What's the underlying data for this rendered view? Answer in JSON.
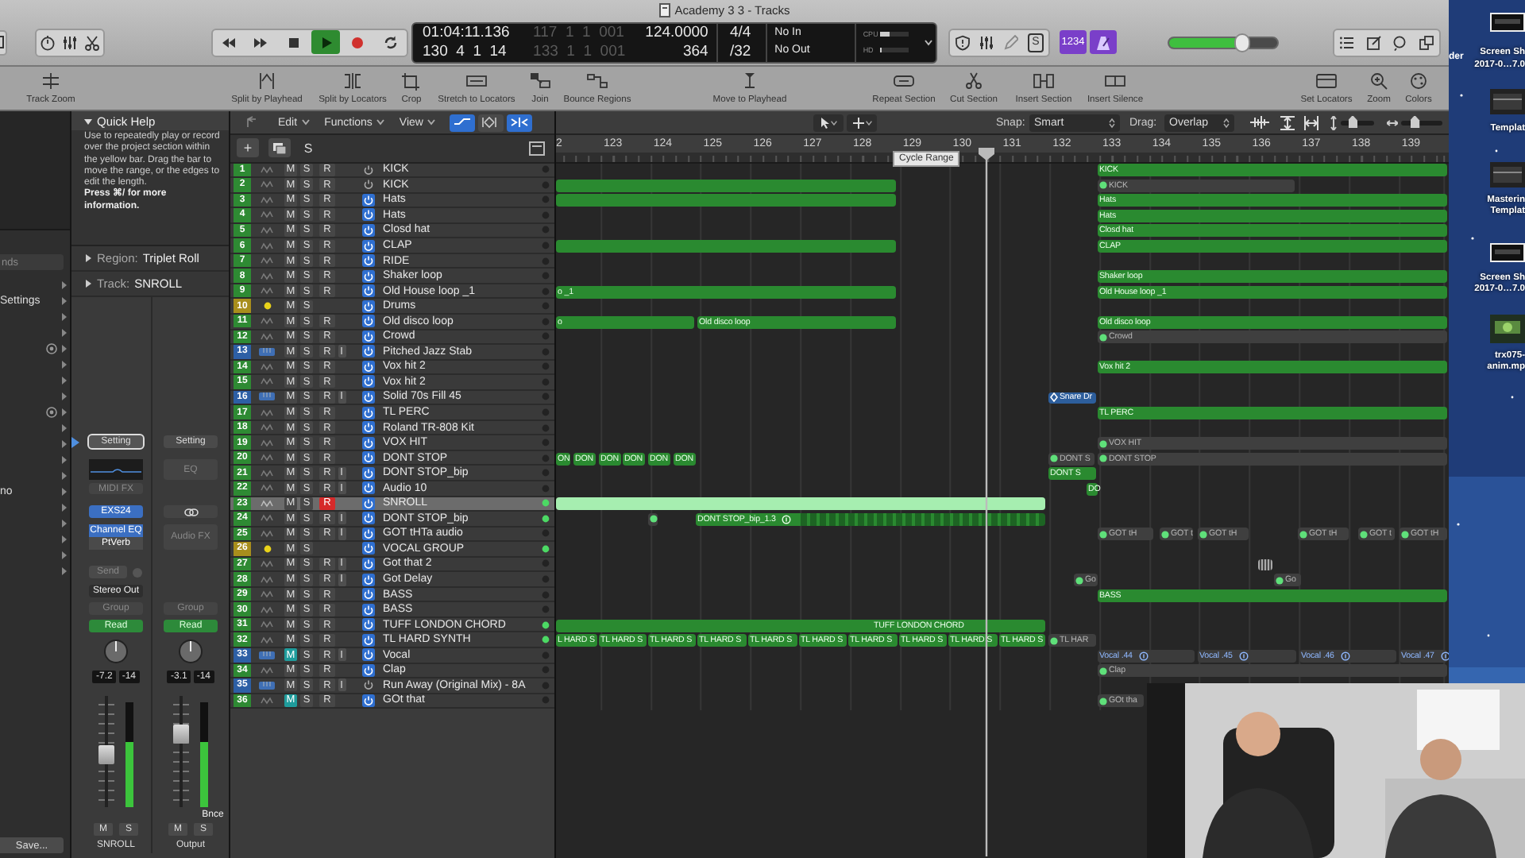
{
  "window": {
    "title": "Academy 3 3 - Tracks"
  },
  "transport": [
    {
      "kind": "rewind",
      "on": false
    },
    {
      "kind": "forward",
      "on": false
    },
    {
      "kind": "stop",
      "on": false
    },
    {
      "kind": "play",
      "on": true
    },
    {
      "kind": "record",
      "on": false
    },
    {
      "kind": "cycle",
      "on": false
    }
  ],
  "lcd": {
    "time": "01:04:11.136",
    "bars": "130  4  1  14",
    "left_locator": "117  1  1  001",
    "right_locator": "133  1  1  001",
    "tempo": "124.0000",
    "tempo_2": "364",
    "signature": "4/4",
    "division": "/32",
    "midi_in": "No In",
    "midi_out": "No Out",
    "cpu": {
      "label": "CPU",
      "level": 0.3
    },
    "hd": {
      "label": "HD",
      "level": 0.05
    }
  },
  "editor_button": {
    "label": "S"
  },
  "count_in": {
    "label": "1234",
    "on": true
  },
  "metronome": {
    "on": true
  },
  "master_volume": {
    "level": 0.68
  },
  "toolbar": [
    {
      "label": "Track Zoom",
      "kind": "track-zoom"
    },
    {
      "label": "Split by Playhead",
      "kind": "split-playhead"
    },
    {
      "label": "Split by Locators",
      "kind": "split-locators"
    },
    {
      "label": "Crop",
      "kind": "crop"
    },
    {
      "label": "Stretch to Locators",
      "kind": "stretch"
    },
    {
      "label": "Join",
      "kind": "join"
    },
    {
      "label": "Bounce Regions",
      "kind": "bounce"
    },
    {
      "label": "Move to Playhead",
      "kind": "move-playhead"
    },
    {
      "label": "Repeat Section",
      "kind": "repeat"
    },
    {
      "label": "Cut Section",
      "kind": "cut-section"
    },
    {
      "label": "Insert Section",
      "kind": "insert-section"
    },
    {
      "label": "Insert Silence",
      "kind": "insert-silence"
    },
    {
      "label": "Set Locators",
      "kind": "set-locators"
    },
    {
      "label": "Zoom",
      "kind": "zoom"
    },
    {
      "label": "Colors",
      "kind": "colors"
    }
  ],
  "library": {
    "search_placeholder": "nds",
    "save": "Save...",
    "items": [
      {
        "kind": "plain",
        "expanded": false
      },
      {
        "label": "Settings",
        "kind": "plain",
        "expanded": false
      },
      {
        "kind": "plain",
        "expanded": false
      },
      {
        "kind": "plain",
        "expanded": false
      },
      {
        "kind": "marked",
        "expanded": false
      },
      {
        "kind": "plain",
        "expanded": false
      },
      {
        "kind": "plain",
        "expanded": false
      },
      {
        "kind": "plain",
        "expanded": false
      },
      {
        "kind": "marked",
        "expanded": false
      },
      {
        "kind": "plain",
        "expanded": false
      },
      {
        "kind": "plain",
        "expanded": false
      },
      {
        "kind": "plain",
        "expanded": false
      },
      {
        "kind": "plain",
        "expanded": false
      },
      {
        "label": "no",
        "kind": "plain",
        "expanded": false
      },
      {
        "kind": "plain",
        "expanded": false
      },
      {
        "kind": "plain",
        "expanded": false
      },
      {
        "kind": "plain",
        "expanded": false
      },
      {
        "kind": "plain",
        "expanded": false
      },
      {
        "kind": "plain",
        "expanded": false
      }
    ]
  },
  "inspector": {
    "quick_help": {
      "title": "Quick Help",
      "expanded": true,
      "text": "Use to repeatedly play or record over the project section within the yellow bar. Drag the bar to move the range, or the edges to edit the length.",
      "hint": "Press ⌘/ for more information."
    },
    "region": {
      "label": "Region:",
      "value": "Triplet Roll",
      "expanded": false
    },
    "track": {
      "label": "Track:",
      "value": "SNROLL",
      "expanded": false
    },
    "strips": [
      {
        "kind": "instrument",
        "setting": "Setting",
        "midi_fx": "MIDI FX",
        "instrument": "EXS24",
        "audio_fx": [
          {
            "label": "Channel EQ",
            "selected": true
          },
          {
            "label": "PtVerb",
            "selected": false
          }
        ],
        "send": "Send",
        "output": "Stereo Out",
        "group": "Group",
        "automation": "Read",
        "volume": "-7.2",
        "peak": "-14",
        "fader": {
          "level": 0.46
        },
        "meter": {
          "level": 0.62
        },
        "mute": "M",
        "solo": "S",
        "name": "SNROLL"
      },
      {
        "kind": "output",
        "setting": "Setting",
        "eq": "EQ",
        "audio_fx_slot": "Audio FX",
        "group": "Group",
        "automation": "Read",
        "volume": "-3.1",
        "peak": "-14",
        "fader": {
          "level": 0.69
        },
        "meter": {
          "level": 0.62
        },
        "bounce": "Bnce",
        "mute": "M",
        "solo": "S",
        "name": "Output"
      }
    ]
  },
  "tracks_bar": {
    "menus": [
      {
        "label": "Edit"
      },
      {
        "label": "Functions"
      },
      {
        "label": "View"
      }
    ],
    "toggles": [
      {
        "on": true
      },
      {
        "on": false
      },
      {
        "on": true
      }
    ],
    "add": "+",
    "solo": "S"
  },
  "arrange_bar": {
    "snap_label": "Snap:",
    "snap": "Smart",
    "drag_label": "Drag:",
    "drag": "Overlap",
    "zoom_sliders": [
      {
        "level": 0.3
      },
      {
        "level": 0.28
      }
    ]
  },
  "ruler": {
    "bars": [
      "2",
      "123",
      "124",
      "125",
      "126",
      "127",
      "128",
      "129",
      "130",
      "131",
      "132",
      "133",
      "134",
      "135",
      "136",
      "137",
      "138",
      "139"
    ],
    "tooltip": "Cycle Range"
  },
  "tracks": [
    {
      "number": "1",
      "name": "KICK",
      "kind": "audio",
      "buttons": [
        "M",
        "S",
        "R"
      ],
      "muted": false,
      "record_armed": false,
      "power": false,
      "active": false,
      "selected": false,
      "regions": [
        {
          "label": "KICK",
          "kind": "audio",
          "selected": false
        }
      ]
    },
    {
      "number": "2",
      "name": "KICK",
      "kind": "audio",
      "buttons": [
        "M",
        "S",
        "R"
      ],
      "muted": false,
      "record_armed": false,
      "power": false,
      "active": false,
      "selected": false,
      "regions": [
        {
          "kind": "audio",
          "selected": false
        },
        {
          "label": "KICK",
          "kind": "inactive",
          "selected": false
        }
      ]
    },
    {
      "number": "3",
      "name": "Hats",
      "kind": "audio",
      "buttons": [
        "M",
        "S",
        "R"
      ],
      "muted": false,
      "record_armed": false,
      "power": true,
      "active": false,
      "selected": false,
      "regions": [
        {
          "kind": "audio",
          "selected": false
        },
        {
          "label": "Hats",
          "kind": "audio",
          "selected": false
        }
      ]
    },
    {
      "number": "4",
      "name": "Hats",
      "kind": "audio",
      "buttons": [
        "M",
        "S",
        "R"
      ],
      "muted": false,
      "record_armed": false,
      "power": true,
      "active": false,
      "selected": false,
      "regions": [
        {
          "label": "Hats",
          "kind": "audio",
          "selected": false
        }
      ]
    },
    {
      "number": "5",
      "name": "Closd hat",
      "kind": "audio",
      "buttons": [
        "M",
        "S",
        "R"
      ],
      "muted": false,
      "record_armed": false,
      "power": true,
      "active": false,
      "selected": false,
      "regions": [
        {
          "label": "Closd hat",
          "kind": "audio",
          "selected": false
        }
      ]
    },
    {
      "number": "6",
      "name": "CLAP",
      "kind": "audio",
      "buttons": [
        "M",
        "S",
        "R"
      ],
      "muted": false,
      "record_armed": false,
      "power": true,
      "active": false,
      "selected": false,
      "regions": [
        {
          "kind": "audio",
          "selected": false
        },
        {
          "label": "CLAP",
          "kind": "audio",
          "selected": false
        }
      ]
    },
    {
      "number": "7",
      "name": "RIDE",
      "kind": "audio",
      "buttons": [
        "M",
        "S",
        "R"
      ],
      "muted": false,
      "record_armed": false,
      "power": true,
      "active": false,
      "selected": false
    },
    {
      "number": "8",
      "name": "Shaker loop",
      "kind": "audio",
      "buttons": [
        "M",
        "S",
        "R"
      ],
      "muted": false,
      "record_armed": false,
      "power": true,
      "active": false,
      "selected": false,
      "regions": [
        {
          "label": "Shaker loop",
          "kind": "audio",
          "selected": false
        }
      ]
    },
    {
      "number": "9",
      "name": "Old House loop _1",
      "kind": "audio",
      "buttons": [
        "M",
        "S",
        "R"
      ],
      "muted": false,
      "record_armed": false,
      "power": true,
      "active": false,
      "selected": false,
      "regions": [
        {
          "label": "o _1",
          "kind": "audio",
          "selected": false
        },
        {
          "label": "Old House loop _1",
          "kind": "audio",
          "selected": false
        }
      ]
    },
    {
      "number": "10",
      "name": "Drums",
      "kind": "stack",
      "buttons": [
        "M",
        "S"
      ],
      "muted": false,
      "power": true,
      "active": false,
      "selected": false
    },
    {
      "number": "11",
      "name": "Old disco  loop",
      "kind": "audio",
      "buttons": [
        "M",
        "S",
        "R"
      ],
      "muted": false,
      "record_armed": false,
      "power": true,
      "active": false,
      "selected": false,
      "regions": [
        {
          "label": "o",
          "kind": "audio",
          "selected": false
        },
        {
          "label": "Old disco  loop",
          "kind": "audio",
          "selected": false
        },
        {
          "label": "Old disco  loop",
          "kind": "audio",
          "selected": false
        }
      ]
    },
    {
      "number": "12",
      "name": "Crowd",
      "kind": "audio",
      "buttons": [
        "M",
        "S",
        "R"
      ],
      "muted": false,
      "record_armed": false,
      "power": true,
      "active": false,
      "selected": false,
      "regions": [
        {
          "label": "Crowd",
          "kind": "inactive",
          "selected": false
        }
      ]
    },
    {
      "number": "13",
      "name": "Pitched Jazz Stab",
      "kind": "instrument",
      "buttons": [
        "M",
        "S",
        "R",
        "I"
      ],
      "muted": false,
      "record_armed": false,
      "power": true,
      "active": false,
      "selected": false
    },
    {
      "number": "14",
      "name": "Vox hit 2",
      "kind": "audio",
      "buttons": [
        "M",
        "S",
        "R"
      ],
      "muted": false,
      "record_armed": false,
      "power": true,
      "active": false,
      "selected": false,
      "regions": [
        {
          "label": "Vox hit 2",
          "kind": "audio",
          "selected": false
        }
      ]
    },
    {
      "number": "15",
      "name": "Vox hit 2",
      "kind": "audio",
      "buttons": [
        "M",
        "S",
        "R"
      ],
      "muted": false,
      "record_armed": false,
      "power": true,
      "active": false,
      "selected": false
    },
    {
      "number": "16",
      "name": "Solid 70s Fill 45",
      "kind": "instrument",
      "buttons": [
        "M",
        "S",
        "R",
        "I"
      ],
      "muted": false,
      "record_armed": false,
      "power": true,
      "active": false,
      "selected": false,
      "regions": [
        {
          "label": "Snare Dr",
          "kind": "midi",
          "selected": false
        }
      ]
    },
    {
      "number": "17",
      "name": "TL PERC",
      "kind": "audio",
      "buttons": [
        "M",
        "S",
        "R"
      ],
      "muted": false,
      "record_armed": false,
      "power": true,
      "active": false,
      "selected": false,
      "regions": [
        {
          "label": "TL PERC",
          "kind": "audio",
          "selected": false
        }
      ]
    },
    {
      "number": "18",
      "name": "Roland TR-808 Kit",
      "kind": "audio",
      "buttons": [
        "M",
        "S",
        "R"
      ],
      "muted": false,
      "record_armed": false,
      "power": true,
      "active": false,
      "selected": false
    },
    {
      "number": "19",
      "name": "VOX HIT",
      "kind": "audio",
      "buttons": [
        "M",
        "S",
        "R"
      ],
      "muted": false,
      "record_armed": false,
      "power": true,
      "active": false,
      "selected": false,
      "regions": [
        {
          "label": "VOX HIT",
          "kind": "inactive",
          "selected": false
        }
      ]
    },
    {
      "number": "20",
      "name": "DONT STOP",
      "kind": "audio",
      "buttons": [
        "M",
        "S",
        "R"
      ],
      "muted": false,
      "record_armed": false,
      "power": true,
      "active": false,
      "selected": false,
      "regions": [
        {
          "label": "ON",
          "kind": "audio",
          "selected": false
        },
        {
          "label": "DON",
          "kind": "audio",
          "selected": false
        },
        {
          "label": "DON",
          "kind": "audio",
          "selected": false
        },
        {
          "label": "DON",
          "kind": "audio",
          "selected": false
        },
        {
          "label": "DON",
          "kind": "audio",
          "selected": false
        },
        {
          "label": "DON",
          "kind": "audio",
          "selected": false
        },
        {
          "label": "DONT S",
          "kind": "inactive",
          "selected": false
        },
        {
          "label": "DONT STOP",
          "kind": "inactive",
          "selected": false
        }
      ]
    },
    {
      "number": "21",
      "name": "DONT STOP_bip",
      "kind": "audio",
      "buttons": [
        "M",
        "S",
        "R",
        "I"
      ],
      "muted": false,
      "record_armed": false,
      "power": true,
      "active": false,
      "selected": false,
      "regions": [
        {
          "label": "DONT S",
          "kind": "audio",
          "selected": false
        }
      ]
    },
    {
      "number": "22",
      "name": "Audio 10",
      "kind": "audio",
      "buttons": [
        "M",
        "S",
        "R",
        "I"
      ],
      "muted": false,
      "record_armed": false,
      "power": true,
      "active": false,
      "selected": false,
      "regions": [
        {
          "label": "DO",
          "kind": "audio",
          "selected": false
        }
      ]
    },
    {
      "number": "23",
      "name": "SNROLL",
      "kind": "audio",
      "buttons": [
        "M",
        "S",
        "R"
      ],
      "muted": false,
      "record_armed": true,
      "power": true,
      "active": true,
      "selected": true,
      "regions": [
        {
          "kind": "audio",
          "selected": true
        }
      ]
    },
    {
      "number": "24",
      "name": "DONT STOP_bip",
      "kind": "audio",
      "buttons": [
        "M",
        "S",
        "R",
        "I"
      ],
      "muted": false,
      "record_armed": false,
      "power": true,
      "active": true,
      "selected": false,
      "regions": [
        {
          "kind": "inactive",
          "selected": false
        },
        {
          "label": "DONT STOP_bip_1.3",
          "kind": "looped",
          "selected": false
        }
      ]
    },
    {
      "number": "25",
      "name": "GOT tHTa audio",
      "kind": "audio",
      "buttons": [
        "M",
        "S",
        "R",
        "I"
      ],
      "muted": false,
      "record_armed": false,
      "power": true,
      "active": false,
      "selected": false,
      "regions": [
        {
          "label": "GOT tH",
          "kind": "inactive",
          "selected": false
        },
        {
          "label": "GOT t",
          "kind": "inactive",
          "selected": false
        },
        {
          "label": "GOT tH",
          "kind": "inactive",
          "selected": false
        },
        {
          "label": "GOT tH",
          "kind": "inactive",
          "selected": false
        },
        {
          "label": "GOT t",
          "kind": "inactive",
          "selected": false
        },
        {
          "label": "GOT tH",
          "kind": "inactive",
          "selected": false
        }
      ]
    },
    {
      "number": "26",
      "name": "VOCAL GROUP",
      "kind": "stack",
      "buttons": [
        "M",
        "S"
      ],
      "muted": false,
      "power": true,
      "active": true,
      "selected": false
    },
    {
      "number": "27",
      "name": "Got that 2",
      "kind": "audio",
      "buttons": [
        "M",
        "S",
        "R",
        "I"
      ],
      "muted": false,
      "record_armed": false,
      "power": true,
      "active": false,
      "selected": false,
      "regions": [
        {
          "kind": "stub",
          "selected": false
        }
      ]
    },
    {
      "number": "28",
      "name": "Got Delay",
      "kind": "audio",
      "buttons": [
        "M",
        "S",
        "R",
        "I"
      ],
      "muted": false,
      "record_armed": false,
      "power": true,
      "active": false,
      "selected": false,
      "regions": [
        {
          "label": "Go",
          "kind": "inactive",
          "selected": false
        },
        {
          "label": "Go",
          "kind": "inactive",
          "selected": false
        }
      ]
    },
    {
      "number": "29",
      "name": "BASS",
      "kind": "audio",
      "buttons": [
        "M",
        "S",
        "R"
      ],
      "muted": false,
      "record_armed": false,
      "power": true,
      "active": false,
      "selected": false,
      "regions": [
        {
          "label": "BASS",
          "kind": "audio",
          "selected": false
        }
      ]
    },
    {
      "number": "30",
      "name": "BASS",
      "kind": "audio",
      "buttons": [
        "M",
        "S",
        "R"
      ],
      "muted": false,
      "record_armed": false,
      "power": true,
      "active": false,
      "selected": false
    },
    {
      "number": "31",
      "name": "TUFF LONDON CHORD",
      "kind": "audio",
      "buttons": [
        "M",
        "S",
        "R"
      ],
      "muted": false,
      "record_armed": false,
      "power": true,
      "active": true,
      "selected": false,
      "regions": [
        {
          "label": "TUFF LONDON CHORD",
          "kind": "audio",
          "selected": false
        }
      ]
    },
    {
      "number": "32",
      "name": "TL HARD SYNTH",
      "kind": "audio",
      "buttons": [
        "M",
        "S",
        "R"
      ],
      "muted": false,
      "record_armed": false,
      "power": true,
      "active": true,
      "selected": false,
      "regions": [
        {
          "label": "L HARD S",
          "kind": "audio",
          "selected": false
        },
        {
          "label": "TL HARD S",
          "kind": "audio",
          "selected": false
        },
        {
          "label": "TL HARD S",
          "kind": "audio",
          "selected": false
        },
        {
          "label": "TL HARD S",
          "kind": "audio",
          "selected": false
        },
        {
          "label": "TL HARD S",
          "kind": "audio",
          "selected": false
        },
        {
          "label": "TL HARD S",
          "kind": "audio",
          "selected": false
        },
        {
          "label": "TL HARD S",
          "kind": "audio",
          "selected": false
        },
        {
          "label": "TL HARD S",
          "kind": "audio",
          "selected": false
        },
        {
          "label": "TL HARD S",
          "kind": "audio",
          "selected": false
        },
        {
          "label": "TL HARD S",
          "kind": "audio",
          "selected": false
        },
        {
          "label": "TL HAR",
          "kind": "inactive",
          "selected": false
        }
      ]
    },
    {
      "number": "33",
      "name": "Vocal",
      "kind": "instrument",
      "buttons": [
        "M",
        "S",
        "R",
        "I"
      ],
      "muted": true,
      "record_armed": false,
      "power": true,
      "active": false,
      "selected": false,
      "regions": [
        {
          "label": "Vocal .44",
          "kind": "comp",
          "selected": false
        },
        {
          "label": "Vocal .45",
          "kind": "comp",
          "selected": false
        },
        {
          "label": "Vocal .46",
          "kind": "comp",
          "selected": false
        },
        {
          "label": "Vocal .47",
          "kind": "comp",
          "selected": false
        }
      ]
    },
    {
      "number": "34",
      "name": "Clap",
      "kind": "audio",
      "buttons": [
        "M",
        "S",
        "R"
      ],
      "muted": false,
      "record_armed": false,
      "power": true,
      "active": false,
      "selected": false,
      "regions": [
        {
          "label": "Clap",
          "kind": "inactive",
          "selected": false
        }
      ]
    },
    {
      "number": "35",
      "name": "Run Away (Original Mix) - 8A",
      "kind": "instrument",
      "buttons": [
        "M",
        "S",
        "R",
        "I"
      ],
      "muted": false,
      "record_armed": false,
      "power": false,
      "active": false,
      "selected": false
    },
    {
      "number": "36",
      "name": "GOt that",
      "kind": "audio",
      "buttons": [
        "M",
        "S",
        "R"
      ],
      "muted": true,
      "record_armed": false,
      "power": true,
      "active": false,
      "selected": false,
      "regions": [
        {
          "label": "GOt tha",
          "kind": "inactive",
          "selected": false
        }
      ]
    }
  ],
  "desktop": {
    "side_label": "der",
    "items": [
      {
        "kind": "screenshot",
        "lines": [
          "Screen Sh",
          "2017-0…7.0"
        ]
      },
      {
        "kind": "template",
        "lines": [
          "Templat"
        ]
      },
      {
        "kind": "template",
        "lines": [
          "Masterin",
          "Templat"
        ]
      },
      {
        "kind": "screenshot",
        "lines": [
          "Screen Sh",
          "2017-0…7.0"
        ]
      },
      {
        "kind": "video",
        "lines": [
          "trx075-",
          "anim.mp"
        ]
      }
    ]
  }
}
